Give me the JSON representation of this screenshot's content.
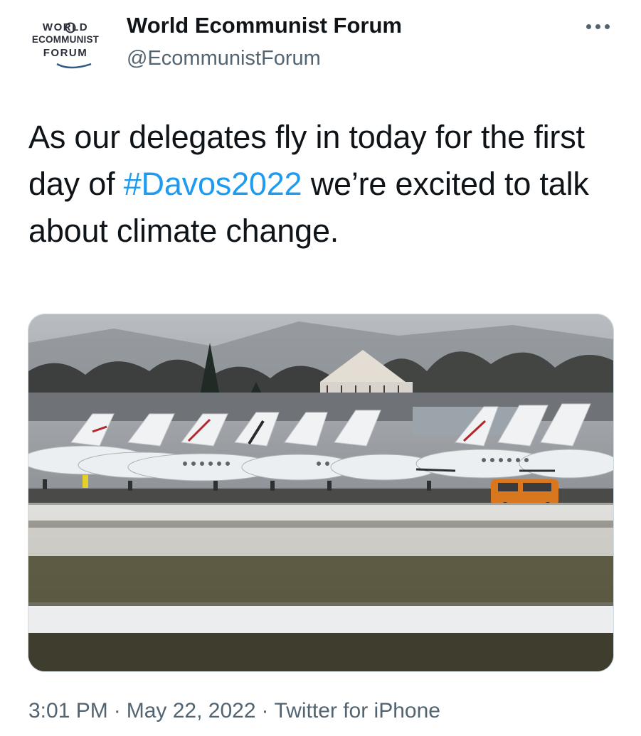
{
  "author": {
    "logo_text": [
      "WORLD",
      "ECOMMUNIST",
      "FORUM"
    ],
    "display_name": "World Ecommunist Forum",
    "handle": "@EcommunistForum"
  },
  "tweet": {
    "text_before": "As our delegates fly in today for the first day of ",
    "hashtag": "#Davos2022",
    "text_after": " we’re excited to talk about climate change."
  },
  "meta": {
    "time": "3:01 PM",
    "separator": "·",
    "date": "May 22, 2022",
    "source": "Twitter for iPhone"
  },
  "icons": {
    "more": "more-horizontal-icon"
  },
  "colors": {
    "text": "#0f1419",
    "secondary": "#536471",
    "link": "#1d9bf0"
  }
}
